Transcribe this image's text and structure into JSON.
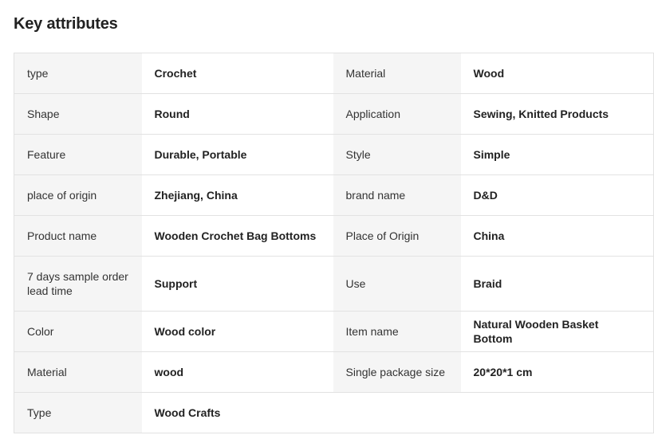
{
  "section": {
    "title": "Key attributes"
  },
  "rows": [
    {
      "k1": "type",
      "v1": "Crochet",
      "k2": "Material",
      "v2": "Wood"
    },
    {
      "k1": "Shape",
      "v1": "Round",
      "k2": "Application",
      "v2": "Sewing, Knitted Products"
    },
    {
      "k1": "Feature",
      "v1": "Durable, Portable",
      "k2": "Style",
      "v2": "Simple"
    },
    {
      "k1": "place of origin",
      "v1": "Zhejiang, China",
      "k2": "brand name",
      "v2": "D&D"
    },
    {
      "k1": "Product name",
      "v1": "Wooden Crochet Bag Bottoms",
      "k2": "Place of Origin",
      "v2": "China"
    },
    {
      "k1": "7 days sample order lead time",
      "v1": "Support",
      "k2": "Use",
      "v2": "Braid"
    },
    {
      "k1": "Color",
      "v1": "Wood color",
      "k2": "Item name",
      "v2": "Natural Wooden Basket Bottom"
    },
    {
      "k1": "Material",
      "v1": "wood",
      "k2": "Single package size",
      "v2": "20*20*1 cm"
    },
    {
      "k1": "Type",
      "v1": "Wood Crafts",
      "k2": "",
      "v2": ""
    }
  ]
}
